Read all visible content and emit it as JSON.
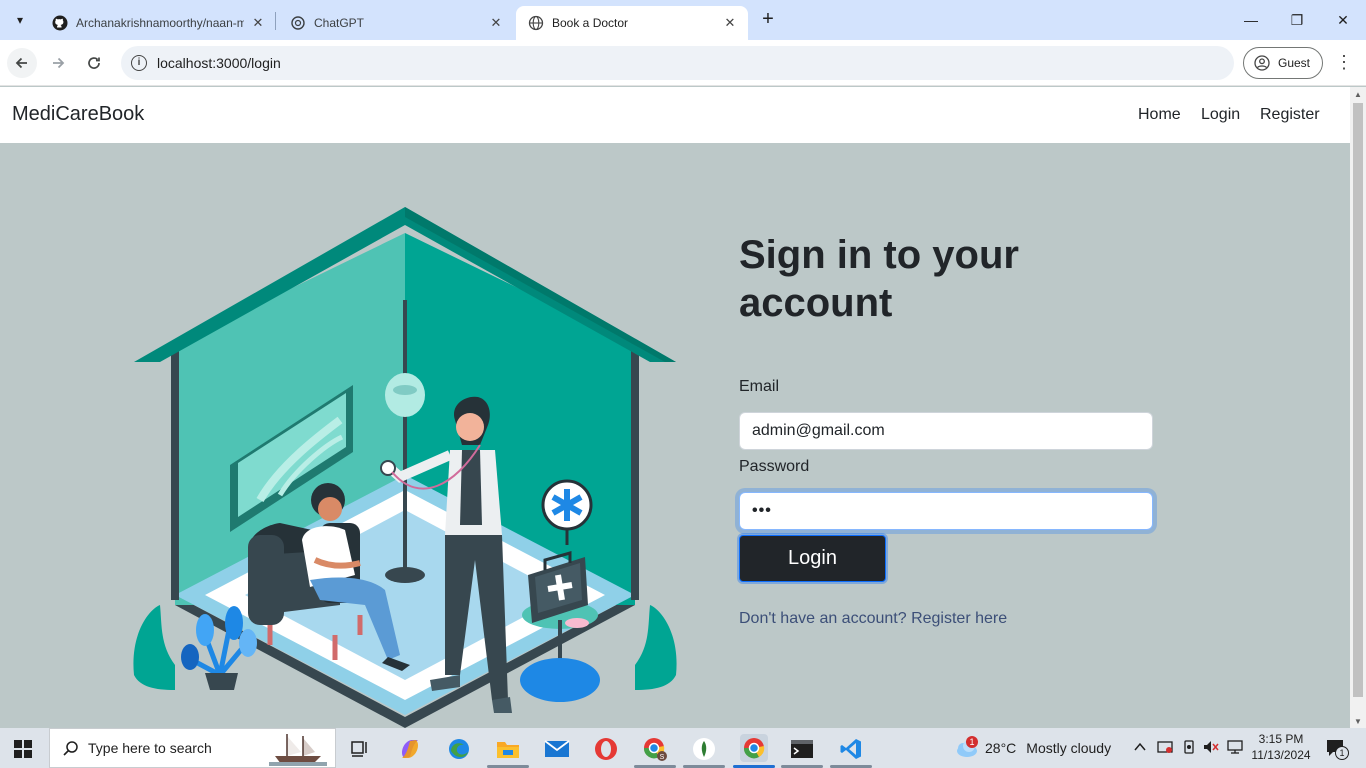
{
  "browser": {
    "tabs": [
      {
        "title": "Archanakrishnamoorthy/naan-m",
        "active": false
      },
      {
        "title": "ChatGPT",
        "active": false
      },
      {
        "title": "Book a Doctor",
        "active": true
      }
    ],
    "url": "localhost:3000/login",
    "profile_label": "Guest"
  },
  "site": {
    "brand": "MediCareBook",
    "nav": [
      "Home",
      "Login",
      "Register"
    ]
  },
  "login": {
    "heading": "Sign in to your account",
    "email_label": "Email",
    "email_value": "admin@gmail.com",
    "password_label": "Password",
    "password_value": "•••",
    "submit_label": "Login",
    "register_link": "Don't have an account? Register here"
  },
  "taskbar": {
    "search_placeholder": "Type here to search",
    "weather_temp": "28°C",
    "weather_desc": "Mostly cloudy",
    "weather_badge": "1",
    "time": "3:15 PM",
    "date": "11/13/2024",
    "notification_count": "1"
  },
  "colors": {
    "page_bg": "#bcc8c8",
    "teal_dark": "#00897b",
    "teal_mid": "#4fc3b4",
    "button_dark": "#212529",
    "link": "#3c4f78"
  }
}
